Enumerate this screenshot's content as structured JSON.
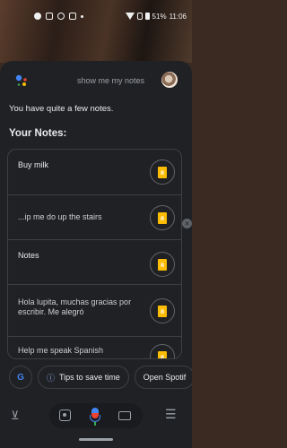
{
  "status_bar": {
    "battery_percent": "51%",
    "time": "11:06"
  },
  "assistant": {
    "query": "show me my notes",
    "response": "You have quite a few notes.",
    "notes_heading": "Your Notes:"
  },
  "notes": [
    {
      "text": "Buy milk"
    },
    {
      "text": "...ip me do up the stairs"
    },
    {
      "text": "Notes"
    },
    {
      "text": "Hola lupita, muchas gracias por escribir. Me alegró"
    },
    {
      "text": "Help me speak Spanish"
    }
  ],
  "chips": {
    "google_label": "G",
    "tips_label": "Tips to save time",
    "open_label": "Open Spotif"
  },
  "colors": {
    "sheet_bg": "#202124",
    "keep_yellow": "#fbbc04",
    "accent_blue": "#4285f4"
  }
}
